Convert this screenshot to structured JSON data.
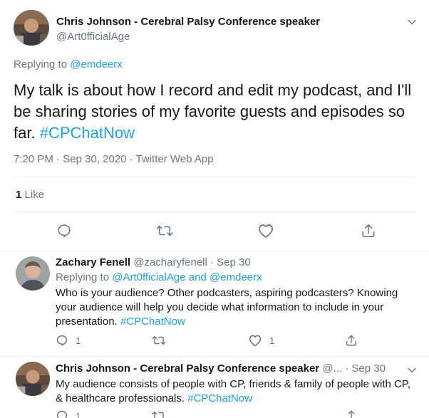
{
  "main_tweet": {
    "author_name": "Chris Johnson - Cerebral Palsy Conference speaker",
    "author_handle": "@Art0fficialAge",
    "replying_prefix": "Replying to",
    "replying_handle": "@emdeerx",
    "text_body": "My talk is about how I record and edit my podcast, and I'll be sharing stories of my favorite guests and episodes so far.",
    "hashtag": "#CPChatNow",
    "time": "7:20 PM",
    "date": "Sep 30, 2020",
    "source": "Twitter Web App",
    "dot": "·",
    "like_count": "1",
    "like_label": "Like"
  },
  "replies": [
    {
      "author_name": "Zachary Fenell",
      "author_handle": "@zacharyfenell",
      "date": "Sep 30",
      "replying_prefix": "Replying to",
      "replying_handle_1": "@Art0fficialAge",
      "replying_and": "and",
      "replying_handle_2": "@emdeerx",
      "text_body": "Who is your audience? Other podcasters, aspiring podcasters? Knowing your audience will help you decide what information to include in your presentation.",
      "hashtag": "#CPChatNow",
      "reply_count": "1",
      "like_count": "1"
    },
    {
      "author_name": "Chris Johnson - Cerebral Palsy Conference speaker",
      "author_handle": "@...",
      "date": "Sep 30",
      "text_body": "My audience consists of people with CP, friends & family of people with CP, & healthcare professionals.",
      "hashtag": "#CPChatNow",
      "reply_count": "1"
    }
  ],
  "icons": {
    "reply": "reply-icon",
    "retweet": "retweet-icon",
    "like": "heart-icon",
    "share": "share-icon",
    "caret": "chevron-down-icon"
  },
  "colors": {
    "link": "#1da1f2",
    "secondary_text": "#657786",
    "primary_text": "#14171a",
    "border": "#e6ecf0"
  }
}
